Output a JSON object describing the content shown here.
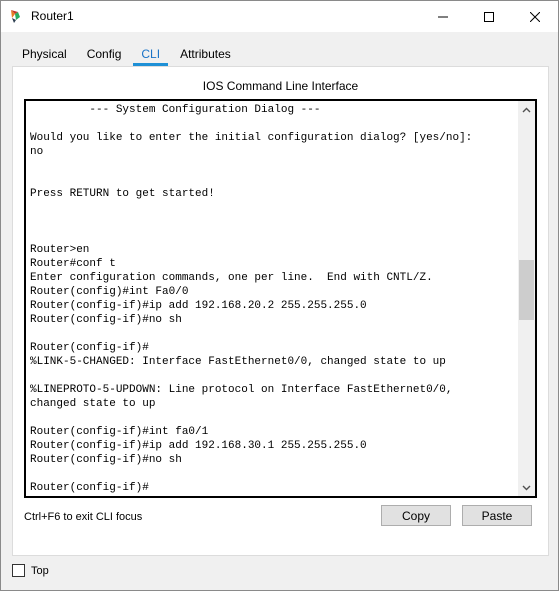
{
  "window": {
    "title": "Router1",
    "accent_color": "#1e90d6",
    "icons": [
      "router-app-icon",
      "minimize-icon",
      "maximize-icon",
      "close-icon"
    ]
  },
  "tabs": [
    {
      "label": "Physical",
      "active": false
    },
    {
      "label": "Config",
      "active": false
    },
    {
      "label": "CLI",
      "active": true
    },
    {
      "label": "Attributes",
      "active": false
    }
  ],
  "panel": {
    "title": "IOS Command Line Interface",
    "terminal_lines": [
      "         --- System Configuration Dialog ---",
      "",
      "Would you like to enter the initial configuration dialog? [yes/no]:",
      "no",
      "",
      "",
      "Press RETURN to get started!",
      "",
      "",
      "",
      "Router>en",
      "Router#conf t",
      "Enter configuration commands, one per line.  End with CNTL/Z.",
      "Router(config)#int Fa0/0",
      "Router(config-if)#ip add 192.168.20.2 255.255.255.0",
      "Router(config-if)#no sh",
      "",
      "Router(config-if)#",
      "%LINK-5-CHANGED: Interface FastEthernet0/0, changed state to up",
      "",
      "%LINEPROTO-5-UPDOWN: Line protocol on Interface FastEthernet0/0,",
      "changed state to up",
      "",
      "Router(config-if)#int fa0/1",
      "Router(config-if)#ip add 192.168.30.1 255.255.255.0",
      "Router(config-if)#no sh",
      "",
      "Router(config-if)#"
    ],
    "hint": "Ctrl+F6 to exit CLI focus",
    "copy_label": "Copy",
    "paste_label": "Paste"
  },
  "footer": {
    "top_label": "Top",
    "top_checked": false
  }
}
